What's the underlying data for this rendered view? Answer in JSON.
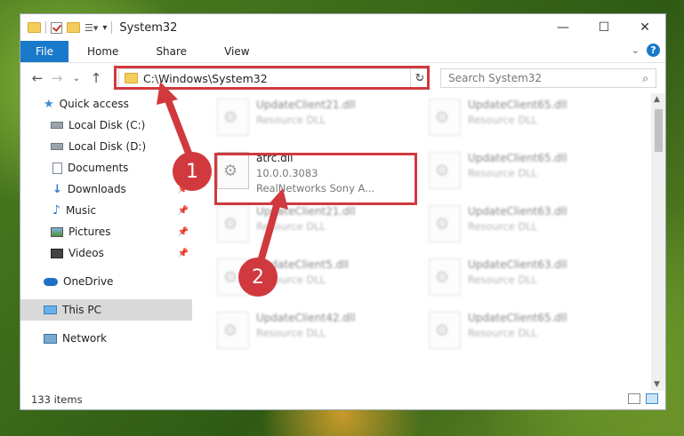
{
  "window": {
    "title": "System32"
  },
  "ribbon": {
    "tabs": [
      "File",
      "Home",
      "Share",
      "View"
    ]
  },
  "address": {
    "path": "C:\\Windows\\System32"
  },
  "search": {
    "placeholder": "Search System32"
  },
  "sidebar": {
    "items": [
      {
        "label": "Quick access",
        "icon": "star-icon"
      },
      {
        "label": "Local Disk (C:)",
        "icon": "disk-icon"
      },
      {
        "label": "Local Disk (D:)",
        "icon": "disk-icon"
      },
      {
        "label": "Documents",
        "icon": "document-icon",
        "pinned": true
      },
      {
        "label": "Downloads",
        "icon": "download-icon",
        "pinned": true
      },
      {
        "label": "Music",
        "icon": "music-icon",
        "pinned": true
      },
      {
        "label": "Pictures",
        "icon": "pictures-icon",
        "pinned": true
      },
      {
        "label": "Videos",
        "icon": "videos-icon",
        "pinned": true
      },
      {
        "label": "OneDrive",
        "icon": "cloud-icon"
      },
      {
        "label": "This PC",
        "icon": "computer-icon",
        "selected": true
      },
      {
        "label": "Network",
        "icon": "network-icon"
      }
    ]
  },
  "files": {
    "highlighted": {
      "name": "atrc.dll",
      "version": "10.0.0.3083",
      "company": "RealNetworks Sony A..."
    },
    "blurred": [
      {
        "name": "UpdateClient21.dll",
        "type": "Resource DLL"
      },
      {
        "name": "UpdateClient65.dll",
        "type": "Resource DLL"
      },
      {
        "name": "UpdateClient65.dll",
        "type": "Resource DLL"
      },
      {
        "name": "UpdateClient21.dll",
        "type": "Resource DLL"
      },
      {
        "name": "UpdateClient63.dll",
        "type": "Resource DLL"
      },
      {
        "name": "UpdateClient5.dll",
        "type": "Resource DLL"
      },
      {
        "name": "UpdateClient63.dll",
        "type": "Resource DLL"
      },
      {
        "name": "UpdateClient42.dll",
        "type": "Resource DLL"
      },
      {
        "name": "UpdateClient65.dll",
        "type": "Resource DLL"
      }
    ]
  },
  "status": {
    "count": "133 items"
  },
  "annotations": {
    "step1": "1",
    "step2": "2",
    "color": "#d0393e"
  }
}
